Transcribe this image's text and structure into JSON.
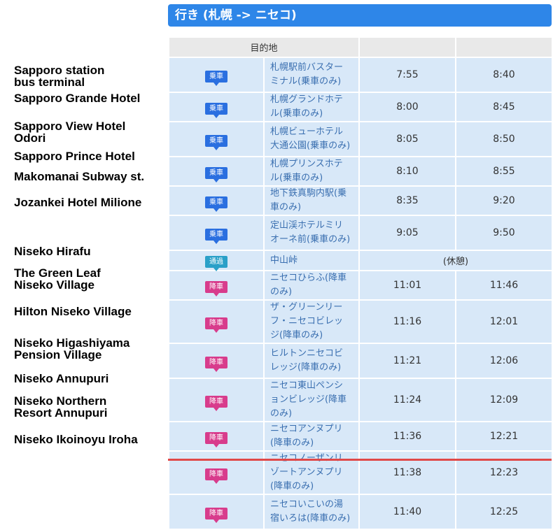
{
  "header": {
    "title": "行き (札幌 -> ニセコ)"
  },
  "table": {
    "col_destination": "目的地"
  },
  "rest_label": "(休憩)",
  "stops": [
    {
      "en": "Sapporo station bus terminal",
      "badge": "乗車",
      "type": "board",
      "jp": "札幌駅前バスターミナル(乗車のみ)",
      "t1": "7:55",
      "t2": "8:40"
    },
    {
      "en": "Sapporo Grande Hotel",
      "badge": "乗車",
      "type": "board",
      "jp": "札幌グランドホテル(乗車のみ)",
      "t1": "8:00",
      "t2": "8:45"
    },
    {
      "en": "Sapporo View Hotel Odori",
      "badge": "乗車",
      "type": "board",
      "jp": "札幌ビューホテル大通公園(乗車のみ)",
      "t1": "8:05",
      "t2": "8:50"
    },
    {
      "en": "Sapporo Prince Hotel",
      "badge": "乗車",
      "type": "board",
      "jp": "札幌プリンスホテル(乗車のみ)",
      "t1": "8:10",
      "t2": "8:55"
    },
    {
      "en": "Makomanai Subway st.",
      "badge": "乗車",
      "type": "board",
      "jp": "地下鉄真駒内駅(乗車のみ)",
      "t1": "8:35",
      "t2": "9:20"
    },
    {
      "en": "Jozankei Hotel Milione",
      "badge": "乗車",
      "type": "board",
      "jp": "定山渓ホテルミリオーネ前(乗車のみ)",
      "t1": "9:05",
      "t2": "9:50"
    },
    {
      "en": "",
      "badge": "通過",
      "type": "pass",
      "jp": "中山峠",
      "rest": true
    },
    {
      "en": "Niseko Hirafu",
      "badge": "降車",
      "type": "alight",
      "jp": "ニセコひらふ(降車のみ)",
      "t1": "11:01",
      "t2": "11:46"
    },
    {
      "en": "The Green Leaf Niseko Village",
      "badge": "降車",
      "type": "alight",
      "jp": "ザ・グリーンリーフ・ニセコビレッジ(降車のみ)",
      "t1": "11:16",
      "t2": "12:01"
    },
    {
      "en": "Hilton Niseko Village",
      "badge": "降車",
      "type": "alight",
      "jp": "ヒルトンニセコビレッジ(降車のみ)",
      "t1": "11:21",
      "t2": "12:06"
    },
    {
      "en": "Niseko Higashiyama Pension Village",
      "badge": "降車",
      "type": "alight",
      "jp": "ニセコ東山ペンションビレッジ(降車のみ)",
      "t1": "11:24",
      "t2": "12:09"
    },
    {
      "en": "Niseko Annupuri",
      "badge": "降車",
      "type": "alight",
      "jp": "ニセコアンヌプリ(降車のみ)",
      "t1": "11:36",
      "t2": "12:21"
    },
    {
      "en": "Niseko Northern Resort Annupuri",
      "badge": "降車",
      "type": "alight",
      "jp": "ニセコノーザンリゾートアンヌプリ(降車のみ)",
      "t1": "11:38",
      "t2": "12:23"
    },
    {
      "en": "Niseko Ikoinoyu Iroha",
      "badge": "降車",
      "type": "alight",
      "jp": "ニセコいこいの湯宿いろは(降車のみ)",
      "t1": "11:40",
      "t2": "12:25"
    }
  ]
}
